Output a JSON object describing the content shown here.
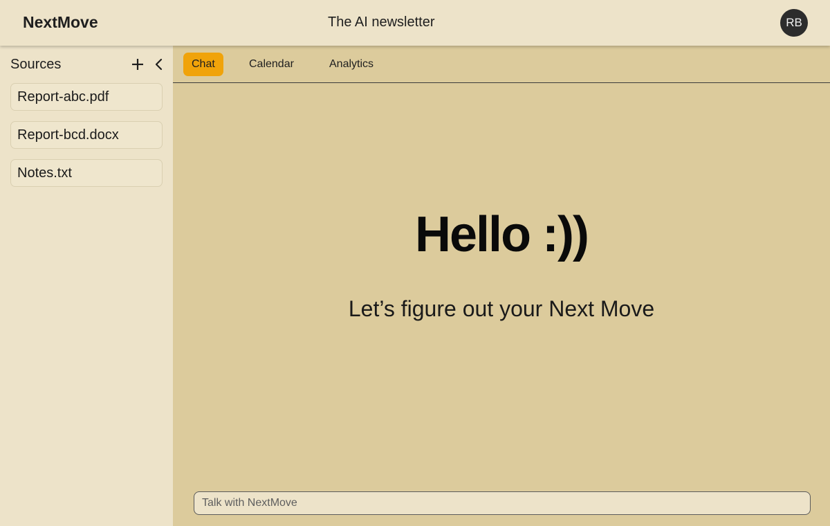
{
  "header": {
    "brand": "NextMove",
    "title": "The AI newsletter",
    "avatar_initials": "RB"
  },
  "sidebar": {
    "title": "Sources",
    "add_icon": "plus-icon",
    "collapse_icon": "chevron-left-icon",
    "items": [
      {
        "label": "Report-abc.pdf"
      },
      {
        "label": "Report-bcd.docx"
      },
      {
        "label": "Notes.txt"
      }
    ]
  },
  "tabs": [
    {
      "label": "Chat",
      "active": true
    },
    {
      "label": "Calendar",
      "active": false
    },
    {
      "label": "Analytics",
      "active": false
    }
  ],
  "hero": {
    "title": "Hello :))",
    "subtitle": "Let’s figure out your Next Move"
  },
  "chat": {
    "placeholder": "Talk with NextMove",
    "value": ""
  },
  "colors": {
    "sidebar_bg": "#ede3c9",
    "main_bg": "#dccb9c",
    "accent": "#f0a30a",
    "avatar_bg": "#2c2c2c"
  }
}
